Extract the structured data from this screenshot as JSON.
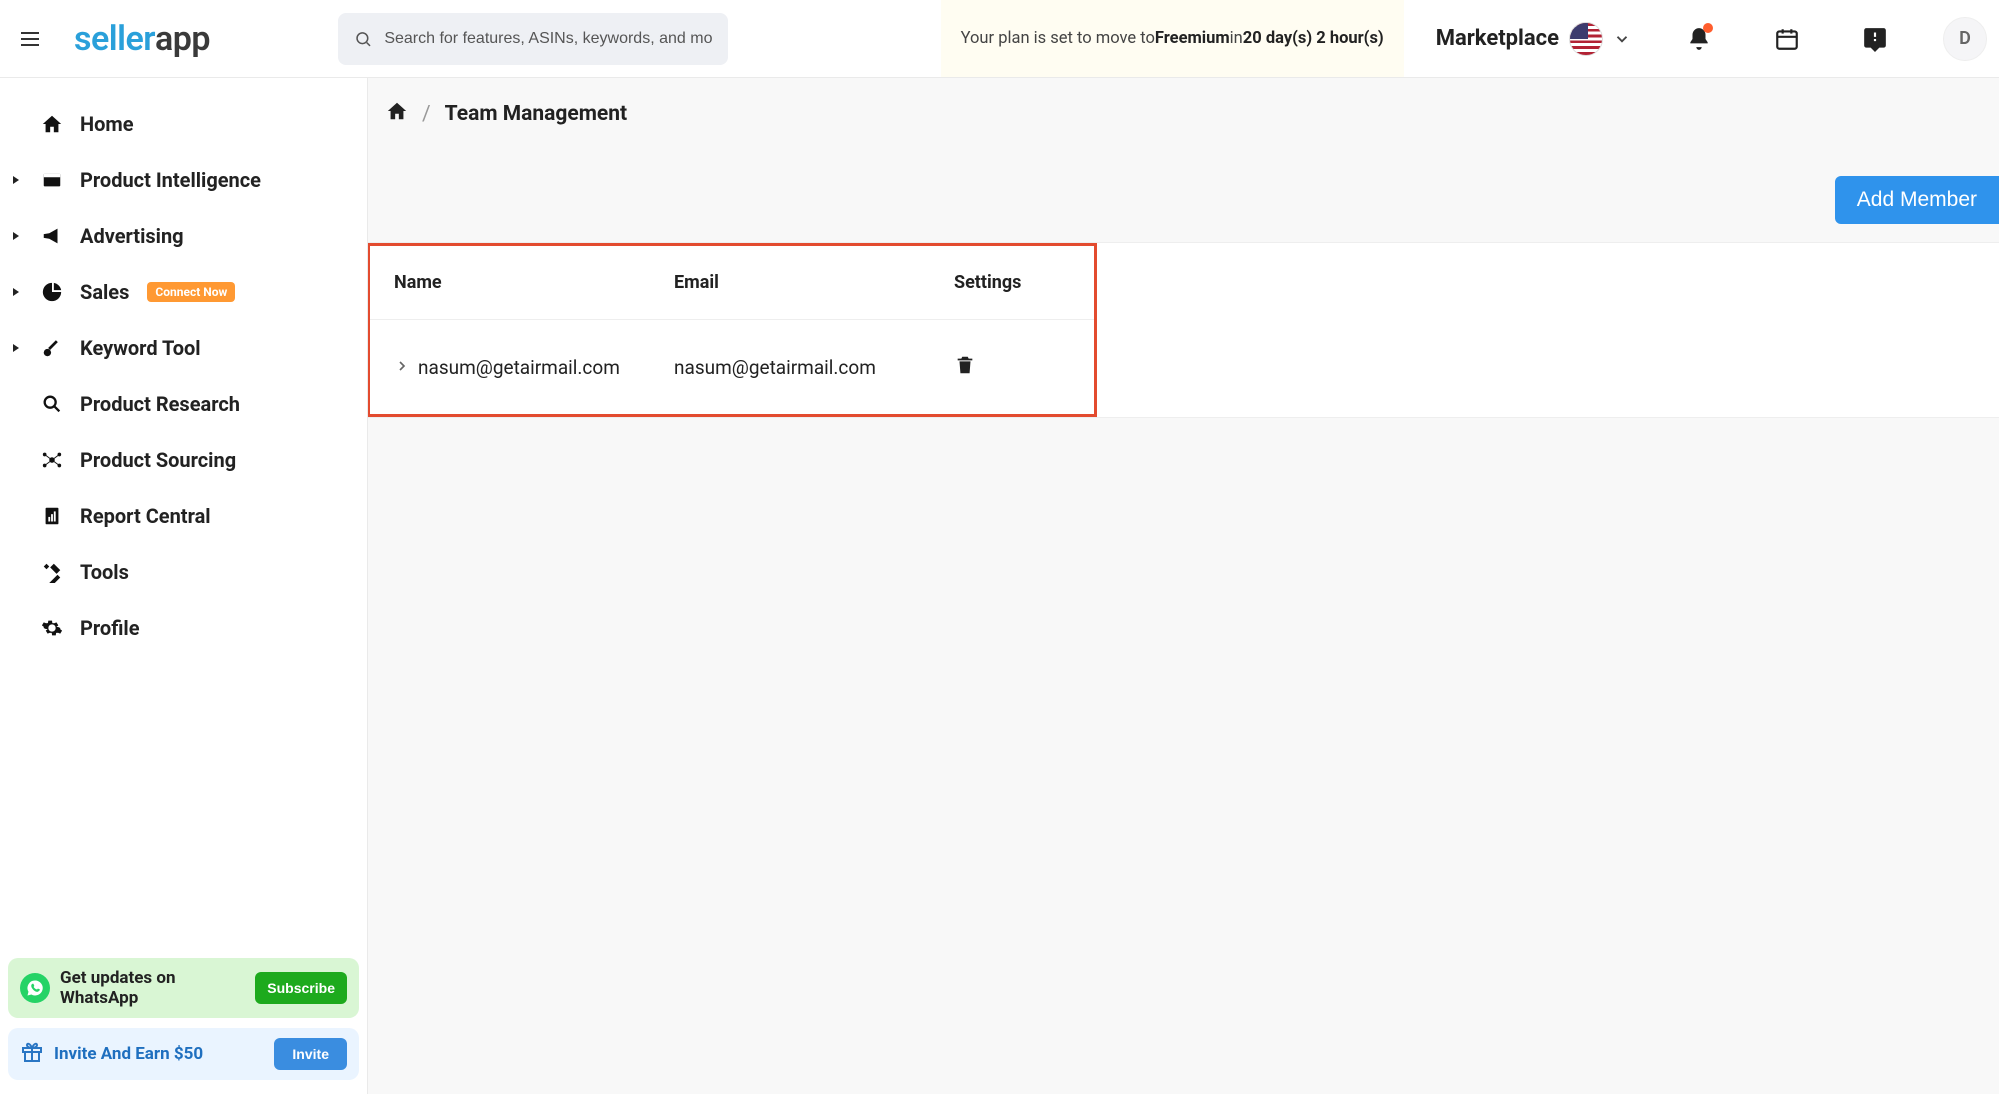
{
  "brand": {
    "part1": "seller",
    "part2": "app"
  },
  "search": {
    "placeholder": "Search for features, ASINs, keywords, and more"
  },
  "plan_banner": {
    "prefix": "Your plan is set to move to ",
    "plan": "Freemium",
    "middle": " in ",
    "countdown": "20 day(s) 2 hour(s)"
  },
  "marketplace_label": "Marketplace",
  "avatar_initial": "D",
  "sidebar": {
    "items": [
      {
        "label": "Home",
        "expandable": false,
        "icon": "home"
      },
      {
        "label": "Product Intelligence",
        "expandable": true,
        "icon": "product-intel"
      },
      {
        "label": "Advertising",
        "expandable": true,
        "icon": "advertising"
      },
      {
        "label": "Sales",
        "expandable": true,
        "icon": "sales",
        "badge": "Connect Now"
      },
      {
        "label": "Keyword Tool",
        "expandable": true,
        "icon": "keyword"
      },
      {
        "label": "Product Research",
        "expandable": false,
        "icon": "research"
      },
      {
        "label": "Product Sourcing",
        "expandable": false,
        "icon": "sourcing"
      },
      {
        "label": "Report Central",
        "expandable": false,
        "icon": "report"
      },
      {
        "label": "Tools",
        "expandable": false,
        "icon": "tools"
      },
      {
        "label": "Profile",
        "expandable": false,
        "icon": "profile"
      }
    ],
    "whatsapp": {
      "text": "Get updates on WhatsApp",
      "button": "Subscribe"
    },
    "invite": {
      "text": "Invite And Earn $50",
      "button": "Invite"
    }
  },
  "breadcrumb": {
    "sep": "/",
    "page": "Team Management"
  },
  "actions": {
    "add_member": "Add Member"
  },
  "table": {
    "headers": {
      "name": "Name",
      "email": "Email",
      "settings": "Settings"
    },
    "rows": [
      {
        "name": "nasum@getairmail.com",
        "email": "nasum@getairmail.com"
      }
    ]
  }
}
